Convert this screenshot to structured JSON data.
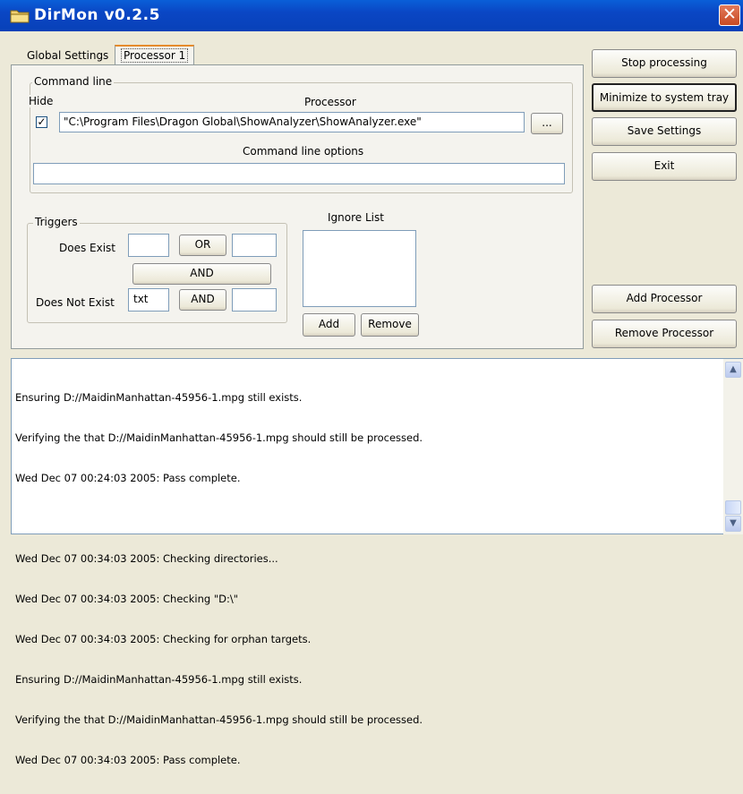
{
  "window": {
    "title": "DirMon v0.2.5",
    "close_glyph": "✕"
  },
  "tabs": [
    {
      "label": "Global Settings"
    },
    {
      "label": "Processor 1"
    }
  ],
  "command_line": {
    "group_label": "Command line",
    "hide_label": "Hide",
    "hide_checked": true,
    "processor_label": "Processor",
    "processor_path": "\"C:\\Program Files\\Dragon Global\\ShowAnalyzer\\ShowAnalyzer.exe\"",
    "browse_label": "...",
    "options_label": "Command line options",
    "options_value": ""
  },
  "triggers": {
    "group_label": "Triggers",
    "does_exist_label": "Does Exist",
    "does_exist_value_1": "",
    "or_label": "OR",
    "does_exist_value_2": "",
    "and_label_mid": "AND",
    "does_not_exist_label": "Does Not Exist",
    "does_not_exist_value_1": "txt",
    "and_label_bottom": "AND",
    "does_not_exist_value_2": ""
  },
  "ignore_list": {
    "label": "Ignore List",
    "items": [],
    "add_label": "Add",
    "remove_label": "Remove"
  },
  "side_buttons": {
    "stop_processing": "Stop processing",
    "minimize_to_tray": "Minimize to system tray",
    "save_settings": "Save Settings",
    "exit": "Exit",
    "add_processor": "Add Processor",
    "remove_processor": "Remove Processor"
  },
  "log": {
    "lines": [
      "Ensuring D://MaidinManhattan-45956-1.mpg still exists.",
      "Verifying the that D://MaidinManhattan-45956-1.mpg should still be processed.",
      "Wed Dec 07 00:24:03 2005: Pass complete.",
      "",
      "Wed Dec 07 00:34:03 2005: Checking directories...",
      "Wed Dec 07 00:34:03 2005: Checking \"D:\\\"",
      "Wed Dec 07 00:34:03 2005: Checking for orphan targets.",
      "Ensuring D://MaidinManhattan-45956-1.mpg still exists.",
      "Verifying the that D://MaidinManhattan-45956-1.mpg should still be processed.",
      "Wed Dec 07 00:34:03 2005: Pass complete."
    ]
  },
  "icons": {
    "app": "folder-icon",
    "scroll_up": "▲",
    "scroll_down": "▼"
  }
}
